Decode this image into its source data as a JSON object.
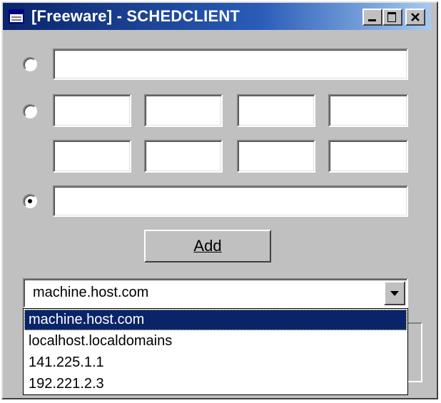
{
  "window": {
    "title": "[Freeware] - SCHEDCLIENT"
  },
  "form": {
    "add_label": "Add"
  },
  "host_combo": {
    "selected": "machine.host.com",
    "options": [
      "machine.host.com",
      "localhost.localdomains",
      "141.225.1.1",
      "192.221.2.3"
    ]
  },
  "colors": {
    "titlebar": "#0a246a",
    "face": "#c0c0c0",
    "selection": "#0a246a"
  }
}
